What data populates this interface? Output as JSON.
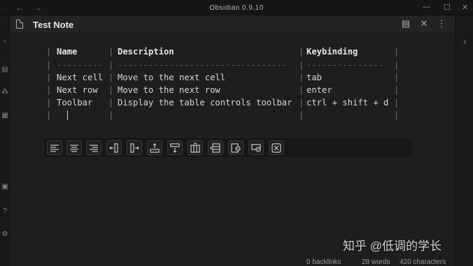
{
  "window": {
    "title": "Obsidian 0.9.10"
  },
  "pane": {
    "title": "Test Note",
    "actions": [
      "reading-view-icon",
      "close-icon",
      "more-options-icon"
    ]
  },
  "table": {
    "header": [
      "Name",
      "Description",
      "Keybinding"
    ],
    "separator": [
      "---------",
      "---------------------------------",
      "---------------"
    ],
    "rows": [
      [
        "Next cell",
        "Move to the next cell",
        "tab"
      ],
      [
        "Next row",
        "Move to the next row",
        "enter"
      ],
      [
        "Toolbar",
        "Display the table controls toolbar",
        "ctrl + shift + d"
      ]
    ]
  },
  "table_toolbar": {
    "buttons": [
      "align-left-icon",
      "align-center-icon",
      "align-right-icon",
      "insert-column-before-icon",
      "insert-column-after-icon",
      "insert-row-before-icon",
      "insert-row-after-icon",
      "move-column-icon",
      "move-row-icon",
      "delete-column-icon",
      "delete-row-icon",
      "close-toolbar-icon"
    ]
  },
  "status": {
    "backlinks": "0 backlinks",
    "words": "28 words",
    "characters": "420 characters"
  },
  "watermark": "知乎 @低调的学长",
  "colors": {
    "background": "#1e1e1e",
    "header": "#242424",
    "text": "#dcddde"
  }
}
